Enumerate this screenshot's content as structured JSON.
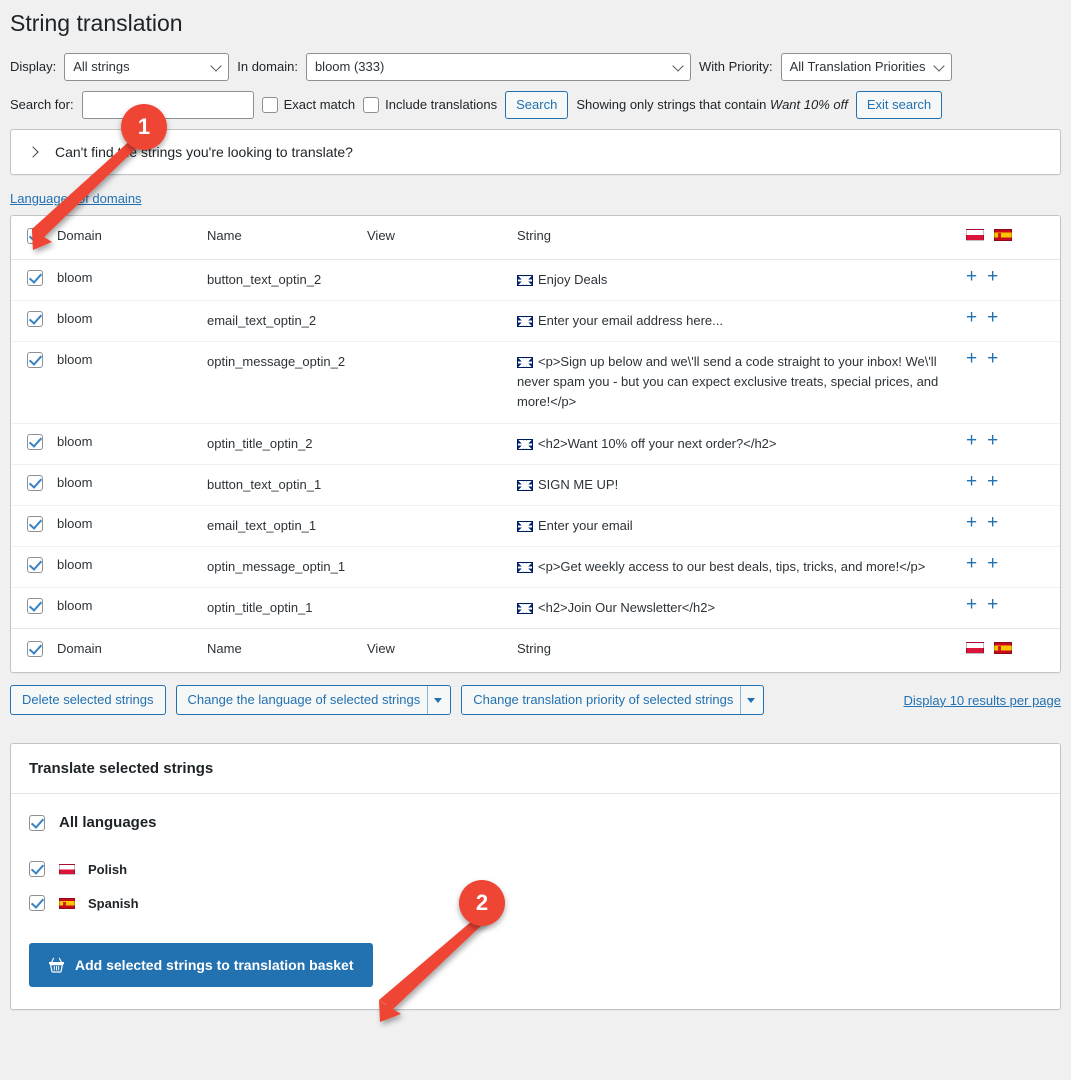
{
  "page": {
    "title": "String translation",
    "accent_blue": "#2271b1",
    "annotation_red": "#ef4535",
    "background": "#f0f0f1"
  },
  "filters": {
    "display_label": "Display:",
    "display_value": "All strings",
    "domain_label": "In domain:",
    "domain_value": "bloom (333)",
    "priority_label": "With Priority:",
    "priority_value": "All Translation Priorities",
    "search_label": "Search for:",
    "search_value": "",
    "search_placeholder": "",
    "exact_match_label": "Exact match",
    "exact_match_checked": false,
    "include_translations_label": "Include translations",
    "include_translations_checked": false,
    "search_button": "Search",
    "showing_prefix": "Showing only strings that contain",
    "showing_term": "Want 10% off",
    "exit_search_button": "Exit search"
  },
  "collapse": {
    "label": "Can't find the strings you're looking to translate?"
  },
  "languages_of_domains_link": "Languages of domains",
  "table": {
    "headers": [
      "Domain",
      "Name",
      "View",
      "String"
    ],
    "header_flags": [
      "polish-flag",
      "spanish-flag"
    ],
    "select_all_checked": true,
    "rows": [
      {
        "checked": true,
        "domain": "bloom",
        "name": "button_text_optin_2",
        "view": "",
        "flag": "uk-flag",
        "string": "Enjoy Deals"
      },
      {
        "checked": true,
        "domain": "bloom",
        "name": "email_text_optin_2",
        "view": "",
        "flag": "uk-flag",
        "string": "Enter your email address here..."
      },
      {
        "checked": true,
        "domain": "bloom",
        "name": "optin_message_optin_2",
        "view": "",
        "flag": "uk-flag",
        "string": "<p>Sign up below and we\\'ll send a code straight to your inbox! We\\'ll never spam you - but you can expect exclusive treats, special prices, and more!</p>"
      },
      {
        "checked": true,
        "domain": "bloom",
        "name": "optin_title_optin_2",
        "view": "",
        "flag": "uk-flag",
        "string": "<h2>Want 10% off your next order?</h2>"
      },
      {
        "checked": true,
        "domain": "bloom",
        "name": "button_text_optin_1",
        "view": "",
        "flag": "uk-flag",
        "string": "SIGN ME UP!"
      },
      {
        "checked": true,
        "domain": "bloom",
        "name": "email_text_optin_1",
        "view": "",
        "flag": "uk-flag",
        "string": "Enter your email"
      },
      {
        "checked": true,
        "domain": "bloom",
        "name": "optin_message_optin_1",
        "view": "",
        "flag": "uk-flag",
        "string": "<p>Get weekly access to our best deals, tips, tricks, and more!</p>"
      },
      {
        "checked": true,
        "domain": "bloom",
        "name": "optin_title_optin_1",
        "view": "",
        "flag": "uk-flag",
        "string": "<h2>Join Our Newsletter</h2>"
      }
    ],
    "row_action_icon": "plus-icon"
  },
  "bulk": {
    "delete_button": "Delete selected strings",
    "change_language": "Change the language of selected strings",
    "change_priority": "Change translation priority of selected strings",
    "per_page_link": "Display 10 results per page"
  },
  "translate_panel": {
    "title": "Translate selected strings",
    "all_languages_label": "All languages",
    "all_languages_checked": true,
    "languages": [
      {
        "label": "Polish",
        "flag": "polish-flag",
        "checked": true
      },
      {
        "label": "Spanish",
        "flag": "spanish-flag",
        "checked": true
      }
    ],
    "basket_button": "Add selected strings to translation basket",
    "basket_icon": "basket-icon"
  },
  "annotations": [
    {
      "number": "1",
      "target": "select-all-checkbox"
    },
    {
      "number": "2",
      "target": "add-to-basket-button"
    }
  ]
}
